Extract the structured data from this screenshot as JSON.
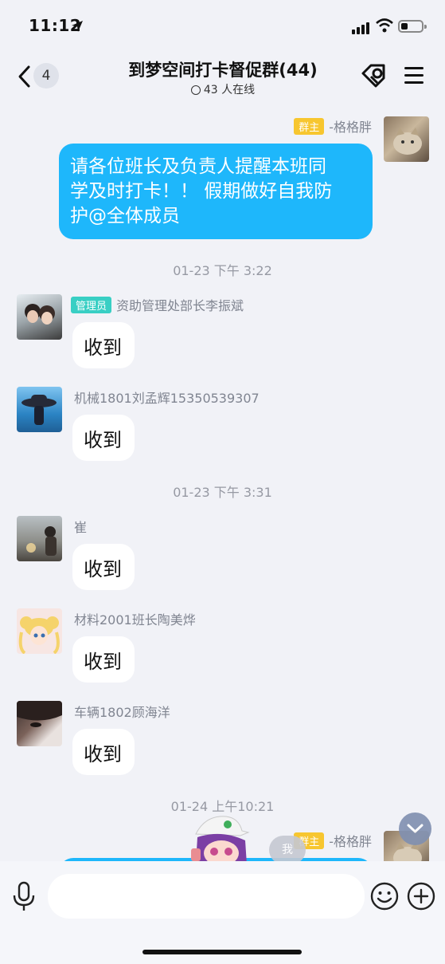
{
  "status": {
    "time": "11:12"
  },
  "nav": {
    "unread_count": "4",
    "title": "到梦空间打卡督促群(44)",
    "online": "43 人在线"
  },
  "messages": [
    {
      "sender": "-格格胖",
      "badge": "群主",
      "text_lines": [
        "请各位班长及负责人提醒本班同",
        "学及时打卡！！ 假期做好自我防",
        "护@全体成员"
      ],
      "side": "right"
    },
    {
      "timestamp": "01-23 下午 3:22"
    },
    {
      "sender": "资助管理处部长李振斌",
      "badge": "管理员",
      "text": "收到",
      "side": "left"
    },
    {
      "sender": "机械1801刘孟辉15350539307",
      "text": "收到",
      "side": "left"
    },
    {
      "timestamp": "01-23 下午 3:31"
    },
    {
      "sender": "崔",
      "text": "收到",
      "side": "left"
    },
    {
      "sender": "材料2001班长陶美烨",
      "text": "收到",
      "side": "left"
    },
    {
      "sender": "车辆1802顾海洋",
      "text": "收到",
      "side": "left"
    },
    {
      "timestamp": "01-24 上午10:21"
    },
    {
      "sender": "-格格胖",
      "badge": "群主",
      "side": "right"
    }
  ],
  "floating": {
    "me_label": "我"
  },
  "input": {
    "value": "",
    "placeholder": ""
  },
  "colors": {
    "accent": "#1eb7fb",
    "owner_badge": "#f7c62f",
    "admin_badge": "#39cfc4",
    "background": "#f1f2f7"
  }
}
